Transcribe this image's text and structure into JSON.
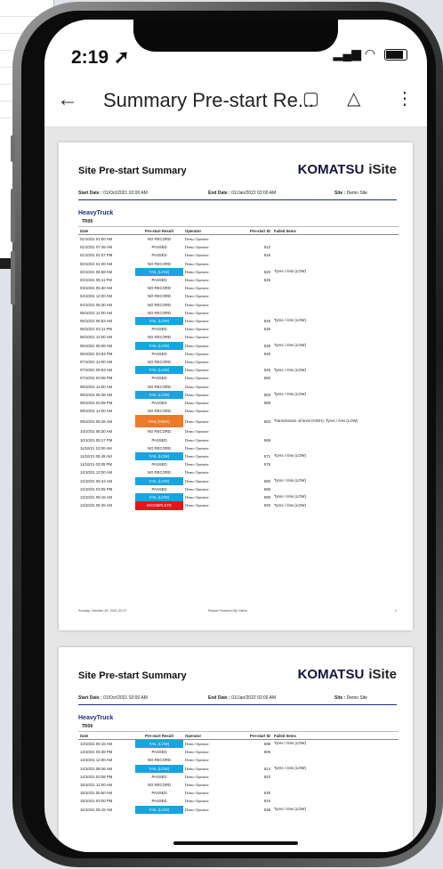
{
  "status": {
    "time": "2:19"
  },
  "appbar": {
    "title": "Summary Pre-start Re..."
  },
  "report": {
    "title": "Site Pre-start Summary",
    "brand": "KOMATSU",
    "brand_sub": "iSite",
    "start_label": "Start Date :",
    "start_value": "01/Oct/2021 02:00 AM",
    "end_label": "End Date :",
    "end_value": "01/Jan/2022 02:00 AM",
    "site_label": "Site :",
    "site_value": "Demo Site",
    "category": "HeavyTruck",
    "machine": "TR06",
    "columns": [
      "Date",
      "Pre-start Result",
      "Operator",
      "Pre-start ID",
      "Failed Items"
    ],
    "footer_date": "Sunday, October 24, 2021 22:27",
    "footer_powered": "Report Powered By iValve",
    "footer_page": "1"
  },
  "page1_rows": [
    [
      "01/10/21 01:00 AM",
      "NO RECORD",
      "Demo Operator",
      "",
      ""
    ],
    [
      "01/10/21 07:48 AM",
      "PASSED",
      "Demo Operator",
      "512",
      ""
    ],
    [
      "01/10/21 04:07 PM",
      "PASSED",
      "Demo Operator",
      "516",
      ""
    ],
    [
      "02/10/21 01:00 AM",
      "NO RECORD",
      "Demo Operator",
      "",
      ""
    ],
    [
      "02/10/21 06:58 AM",
      "FAIL (LOW)",
      "Demo Operator",
      "520",
      "Tyres / rims (LOW)"
    ],
    [
      "02/10/21 05:11 PM",
      "PASSED",
      "Demo Operator",
      "525",
      ""
    ],
    [
      "03/10/21 05:30 AM",
      "NO RECORD",
      "Demo Operator",
      "",
      ""
    ],
    [
      "04/10/21 12:00 AM",
      "NO RECORD",
      "Demo Operator",
      "",
      ""
    ],
    [
      "04/10/21 05:30 AM",
      "NO RECORD",
      "Demo Operator",
      "",
      ""
    ],
    [
      "05/10/21 12:00 AM",
      "NO RECORD",
      "Demo Operator",
      "",
      ""
    ],
    [
      "05/10/21 05:53 AM",
      "FAIL (LOW)",
      "Demo Operator",
      "526",
      "Tyres / rims (LOW)"
    ],
    [
      "05/10/21 03:11 PM",
      "PASSED",
      "Demo Operator",
      "530",
      ""
    ],
    [
      "06/10/21 12:00 AM",
      "NO RECORD",
      "Demo Operator",
      "",
      ""
    ],
    [
      "06/10/21 06:06 AM",
      "FAIL (LOW)",
      "Demo Operator",
      "535",
      "Tyres / rims (LOW)"
    ],
    [
      "06/10/21 03:03 PM",
      "PASSED",
      "Demo Operator",
      "540",
      ""
    ],
    [
      "07/10/21 12:00 AM",
      "NO RECORD",
      "Demo Operator",
      "",
      ""
    ],
    [
      "07/10/21 05:53 AM",
      "FAIL (LOW)",
      "Demo Operator",
      "545",
      "Tyres / rims (LOW)"
    ],
    [
      "07/10/21 03:06 PM",
      "PASSED",
      "Demo Operator",
      "550",
      ""
    ],
    [
      "08/10/21 12:00 AM",
      "NO RECORD",
      "Demo Operator",
      "",
      ""
    ],
    [
      "08/10/21 05:38 AM",
      "FAIL (LOW)",
      "Demo Operator",
      "553",
      "Tyres / rims (LOW)"
    ],
    [
      "08/10/21 03:09 PM",
      "PASSED",
      "Demo Operator",
      "559",
      ""
    ],
    [
      "09/10/21 12:00 AM",
      "NO RECORD",
      "Demo Operator",
      "",
      ""
    ],
    [
      "09/10/21 05:46 AM",
      "FAIL (HIGH)",
      "Demo Operator",
      "563",
      "Transmission oil level (HIGH), Tyres / rims (LOW)"
    ],
    [
      "10/10/21 05:30 AM",
      "NO RECORD",
      "Demo Operator",
      "",
      ""
    ],
    [
      "10/10/21 05:17 PM",
      "PASSED",
      "Demo Operator",
      "569",
      ""
    ],
    [
      "11/10/21 12:00 AM",
      "NO RECORD",
      "Demo Operator",
      "",
      ""
    ],
    [
      "11/10/21 05:49 AM",
      "FAIL (LOW)",
      "Demo Operator",
      "571",
      "Tyres / rims (LOW)"
    ],
    [
      "11/10/21 03:05 PM",
      "PASSED",
      "Demo Operator",
      "576",
      ""
    ],
    [
      "12/10/21 12:00 AM",
      "NO RECORD",
      "Demo Operator",
      "",
      ""
    ],
    [
      "12/10/21 05:43 AM",
      "FAIL (LOW)",
      "Demo Operator",
      "580",
      "Tyres / rims (LOW)"
    ],
    [
      "12/10/21 03:05 PM",
      "PASSED",
      "Demo Operator",
      "585",
      ""
    ],
    [
      "13/10/21 05:16 AM",
      "FAIL (LOW)",
      "Demo Operator",
      "588",
      "Tyres / rims (LOW)"
    ],
    [
      "13/10/21 05:45 AM",
      "INCOMPLETE",
      "Demo Operator",
      "593",
      "Tyres / rims (LOW)"
    ]
  ],
  "page2_rows": [
    [
      "13/10/21 06:15 AM",
      "FAIL (LOW)",
      "Demo Operator",
      "598",
      "Tyres / rims (LOW)"
    ],
    [
      "13/10/21 05:38 PM",
      "PASSED",
      "Demo Operator",
      "605",
      ""
    ],
    [
      "14/10/21 12:00 AM",
      "NO RECORD",
      "Demo Operator",
      "",
      ""
    ],
    [
      "14/10/21 08:46 AM",
      "FAIL (LOW)",
      "Demo Operator",
      "614",
      "Tyres / rims (LOW)"
    ],
    [
      "14/10/21 03:08 PM",
      "PASSED",
      "Demo Operator",
      "622",
      ""
    ],
    [
      "15/10/21 12:00 AM",
      "NO RECORD",
      "Demo Operator",
      "",
      ""
    ],
    [
      "15/10/21 05:50 AM",
      "PASSED",
      "Demo Operator",
      "630",
      ""
    ],
    [
      "15/10/21 03:00 PM",
      "PASSED",
      "Demo Operator",
      "634",
      ""
    ],
    [
      "16/10/21 05:15 AM",
      "FAIL (LOW)",
      "Demo Operator",
      "638",
      "Tyres / rims (LOW)"
    ]
  ],
  "colors": {
    "fail_low": "#1ba3e0",
    "fail_high": "#ec7a2a",
    "incomplete": "#e8141c",
    "accent": "#1f2e7a"
  },
  "icons": [
    "back-arrow-icon",
    "search-doc-icon",
    "add-to-drive-icon",
    "more-vert-icon",
    "location-arrow-icon",
    "signal-icon",
    "wifi-icon",
    "battery-icon"
  ]
}
